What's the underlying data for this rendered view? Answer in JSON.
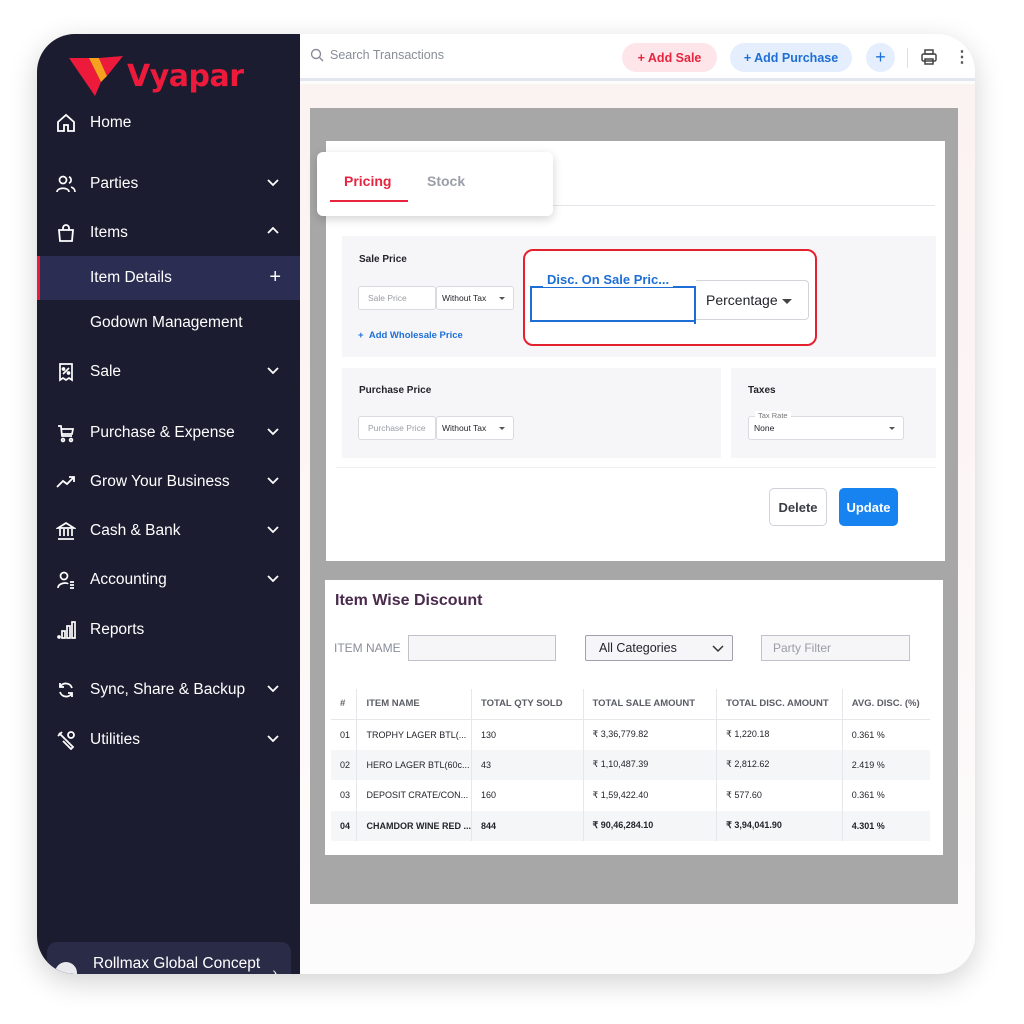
{
  "brand": {
    "name": "Vyapar",
    "color": "#ed1a3b"
  },
  "sidebar": {
    "items": [
      {
        "label": "Home",
        "icon": "home-icon"
      },
      {
        "label": "Parties",
        "icon": "users-icon"
      },
      {
        "label": "Items",
        "icon": "shopping-bag-icon"
      },
      {
        "label": "Item Details"
      },
      {
        "label": "Godown Management"
      },
      {
        "label": "Sale",
        "icon": "receipt-icon"
      },
      {
        "label": "Purchase & Expense",
        "icon": "cart-icon"
      },
      {
        "label": "Grow Your Business",
        "icon": "trending-up-icon"
      },
      {
        "label": "Cash & Bank",
        "icon": "bank-icon"
      },
      {
        "label": "Accounting",
        "icon": "accounting-icon"
      },
      {
        "label": "Reports",
        "icon": "bar-chart-icon"
      },
      {
        "label": "Sync, Share & Backup",
        "icon": "sync-icon"
      },
      {
        "label": "Utilities",
        "icon": "tools-icon"
      }
    ],
    "company": "Rollmax Global Concept"
  },
  "topbar": {
    "search_placeholder": "Search Transactions",
    "add_sale": "+ Add Sale",
    "add_purchase": "+ Add Purchase",
    "plus": "+"
  },
  "item_form": {
    "tabs": [
      "Pricing",
      "Stock"
    ],
    "sale_price": {
      "title": "Sale Price",
      "placeholder": "Sale Price",
      "tax_mode": "Without Tax",
      "wholesale_link": "Add Wholesale Price"
    },
    "discount": {
      "label": "Disc. On Sale Pric...",
      "type": "Percentage"
    },
    "purchase_price": {
      "title": "Purchase Price",
      "placeholder": "Purchase Price",
      "tax_mode": "Without Tax"
    },
    "taxes": {
      "title": "Taxes",
      "field_label": "Tax Rate",
      "value": "None"
    },
    "delete_label": "Delete",
    "update_label": "Update"
  },
  "report": {
    "title": "Item Wise Discount",
    "item_name_label": "ITEM NAME",
    "category_select": "All Categories",
    "party_placeholder": "Party Filter",
    "columns": [
      "#",
      "ITEM NAME",
      "TOTAL QTY SOLD",
      "TOTAL SALE AMOUNT",
      "TOTAL DISC. AMOUNT",
      "AVG. DISC. (%)"
    ],
    "rows": [
      [
        "01",
        "TROPHY LAGER BTL(...",
        "130",
        "₹ 3,36,779.82",
        "₹ 1,220.18",
        "0.361 %"
      ],
      [
        "02",
        "HERO LAGER BTL(60c...",
        "43",
        "₹ 1,10,487.39",
        "₹ 2,812.62",
        "2.419 %"
      ],
      [
        "03",
        "DEPOSIT CRATE/CON...",
        "160",
        "₹ 1,59,422.40",
        "₹ 577.60",
        "0.361 %"
      ],
      [
        "04",
        "CHAMDOR WINE RED ...",
        "844",
        "₹ 90,46,284.10",
        "₹ 3,94,041.90",
        "4.301 %"
      ]
    ]
  },
  "colors": {
    "sidebar_bg": "#1b1c30",
    "accent_red": "#e8253f",
    "accent_blue": "#1683f0",
    "highlight_border": "#e5202f"
  }
}
